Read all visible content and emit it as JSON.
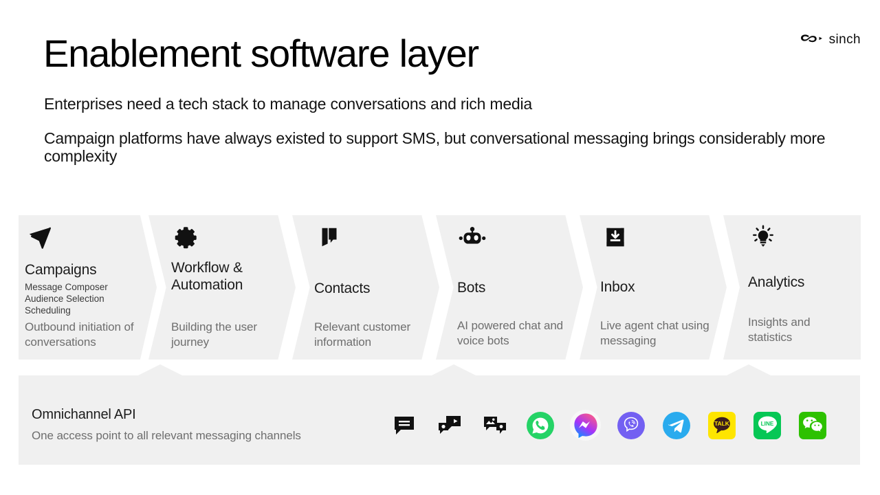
{
  "header": {
    "title": "Enablement software layer",
    "brand": "sinch",
    "brand_icon": "sinch-infinity-logo",
    "subtitle_1": "Enterprises need a tech stack to manage conversations and rich media",
    "subtitle_2": "Campaign platforms have always existed to support SMS, but conversational messaging brings considerably more complexity"
  },
  "pillars": [
    {
      "title": "Campaigns",
      "icon": "paper-plane-icon",
      "features": "Message Composer\nAudience Selection\nScheduling",
      "feature_lines": [
        "Message Composer",
        "Audience Selection",
        "Scheduling"
      ],
      "description": "Outbound initiation of conversations"
    },
    {
      "title": "Workflow & Automation",
      "icon": "gear-icon",
      "features": "",
      "feature_lines": [],
      "description": "Building the user journey"
    },
    {
      "title": "Contacts",
      "icon": "address-book-icon",
      "features": "",
      "feature_lines": [],
      "description": "Relevant customer information"
    },
    {
      "title": "Bots",
      "icon": "robot-icon",
      "features": "",
      "feature_lines": [],
      "description": "AI powered chat and voice bots"
    },
    {
      "title": "Inbox",
      "icon": "inbox-download-icon",
      "features": "",
      "feature_lines": [],
      "description": "Live agent chat using messaging"
    },
    {
      "title": "Analytics",
      "icon": "lightbulb-icon",
      "features": "",
      "feature_lines": [],
      "description": "Insights and statistics"
    }
  ],
  "omnichannel": {
    "title": "Omnichannel API",
    "subtitle": "One access point to all relevant messaging channels",
    "channels": [
      {
        "name": "SMS",
        "icon": "sms-chat-bubble-icon"
      },
      {
        "name": "RCS Video",
        "icon": "video-message-bubble-icon"
      },
      {
        "name": "MMS",
        "icon": "image-message-bubble-icon"
      },
      {
        "name": "WhatsApp",
        "icon": "whatsapp-icon"
      },
      {
        "name": "Messenger",
        "icon": "facebook-messenger-icon"
      },
      {
        "name": "Viber",
        "icon": "viber-icon"
      },
      {
        "name": "Telegram",
        "icon": "telegram-icon"
      },
      {
        "name": "KakaoTalk",
        "icon": "kakaotalk-icon",
        "label": "TALK"
      },
      {
        "name": "LINE",
        "icon": "line-icon",
        "label": "LINE"
      },
      {
        "name": "WeChat",
        "icon": "wechat-icon"
      }
    ]
  },
  "colors": {
    "card_bg": "#f0f0f0",
    "page_bg": "#ffffff",
    "title_text": "#000000",
    "muted_text": "#6e6e6e",
    "whatsapp": "#25D366",
    "messenger_from": "#9B2FFF",
    "messenger_to": "#0695FF",
    "viber": "#7360F2",
    "telegram": "#2AABEE",
    "kakao": "#FEE500",
    "line": "#06C755",
    "wechat": "#2DC100"
  }
}
